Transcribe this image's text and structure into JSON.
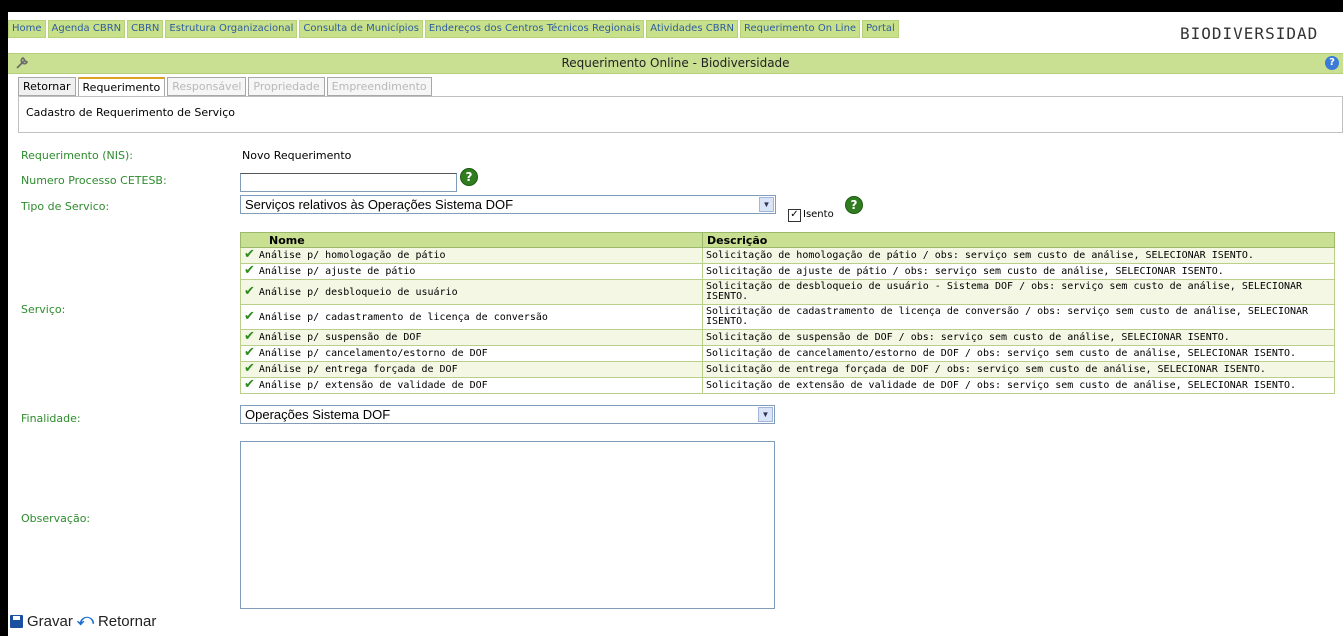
{
  "nav": {
    "links": [
      "Home",
      "Agenda CBRN",
      "CBRN",
      "Estrutura Organizacional",
      "Consulta de Municípios",
      "Endereços dos Centros Técnicos Regionais",
      "Atividades CBRN",
      "Requerimento On Line",
      "Portal"
    ],
    "brand": "BIODIVERSIDAD"
  },
  "titlebar": {
    "title": "Requerimento Online - Biodiversidade",
    "help": "?"
  },
  "tabs": [
    {
      "label": "Retornar",
      "state": "normal"
    },
    {
      "label": "Requerimento",
      "state": "active"
    },
    {
      "label": "Responsável",
      "state": "disabled"
    },
    {
      "label": "Propriedade",
      "state": "disabled"
    },
    {
      "label": "Empreendimento",
      "state": "disabled"
    }
  ],
  "subtitle": "Cadastro de Requerimento de Serviço",
  "form": {
    "nis_label": "Requerimento (NIS):",
    "nis_value": "Novo Requerimento",
    "processo_label": "Numero Processo CETESB:",
    "processo_value": "",
    "tipo_label": "Tipo de Servico:",
    "tipo_value": "Serviços relativos às Operações Sistema DOF",
    "isento_label": "Isento",
    "isento_checked": true,
    "servico_label": "Serviço:",
    "finalidade_label": "Finalidade:",
    "finalidade_value": "Operações Sistema DOF",
    "observacao_label": "Observação:",
    "observacao_value": ""
  },
  "table": {
    "headers": [
      "Nome",
      "Descrição"
    ],
    "rows": [
      {
        "nome": "Análise p/ homologação de pátio",
        "descricao": "Solicitação de homologação de pátio / obs: serviço sem custo de análise, SELECIONAR ISENTO."
      },
      {
        "nome": "Análise p/ ajuste de pátio",
        "descricao": "Solicitação de ajuste de pátio / obs: serviço sem custo de análise, SELECIONAR ISENTO."
      },
      {
        "nome": "Análise p/ desbloqueio de usuário",
        "descricao": "Solicitação de desbloqueio de usuário - Sistema DOF / obs: serviço sem custo de análise, SELECIONAR ISENTO."
      },
      {
        "nome": "Análise p/ cadastramento de licença de conversão",
        "descricao": "Solicitação de cadastramento de licença de conversão / obs: serviço sem custo de análise, SELECIONAR ISENTO."
      },
      {
        "nome": "Análise p/ suspensão de DOF",
        "descricao": "Solicitação de suspensão de DOF / obs: serviço sem custo de análise, SELECIONAR ISENTO."
      },
      {
        "nome": "Análise p/ cancelamento/estorno de DOF",
        "descricao": "Solicitação de cancelamento/estorno de DOF / obs: serviço sem custo de análise, SELECIONAR ISENTO."
      },
      {
        "nome": "Análise p/ entrega forçada de DOF",
        "descricao": "Solicitação de entrega forçada de DOF / obs: serviço sem custo de análise, SELECIONAR ISENTO."
      },
      {
        "nome": "Análise p/ extensão de validade de DOF",
        "descricao": "Solicitação de extensão de validade de DOF / obs: serviço sem custo de análise, SELECIONAR ISENTO."
      }
    ]
  },
  "actions": {
    "gravar": "Gravar",
    "retornar": "Retornar"
  },
  "colors": {
    "accent_green": "#c9df92",
    "label_green": "#2e8b2e",
    "link_blue": "#2f5e9e"
  }
}
